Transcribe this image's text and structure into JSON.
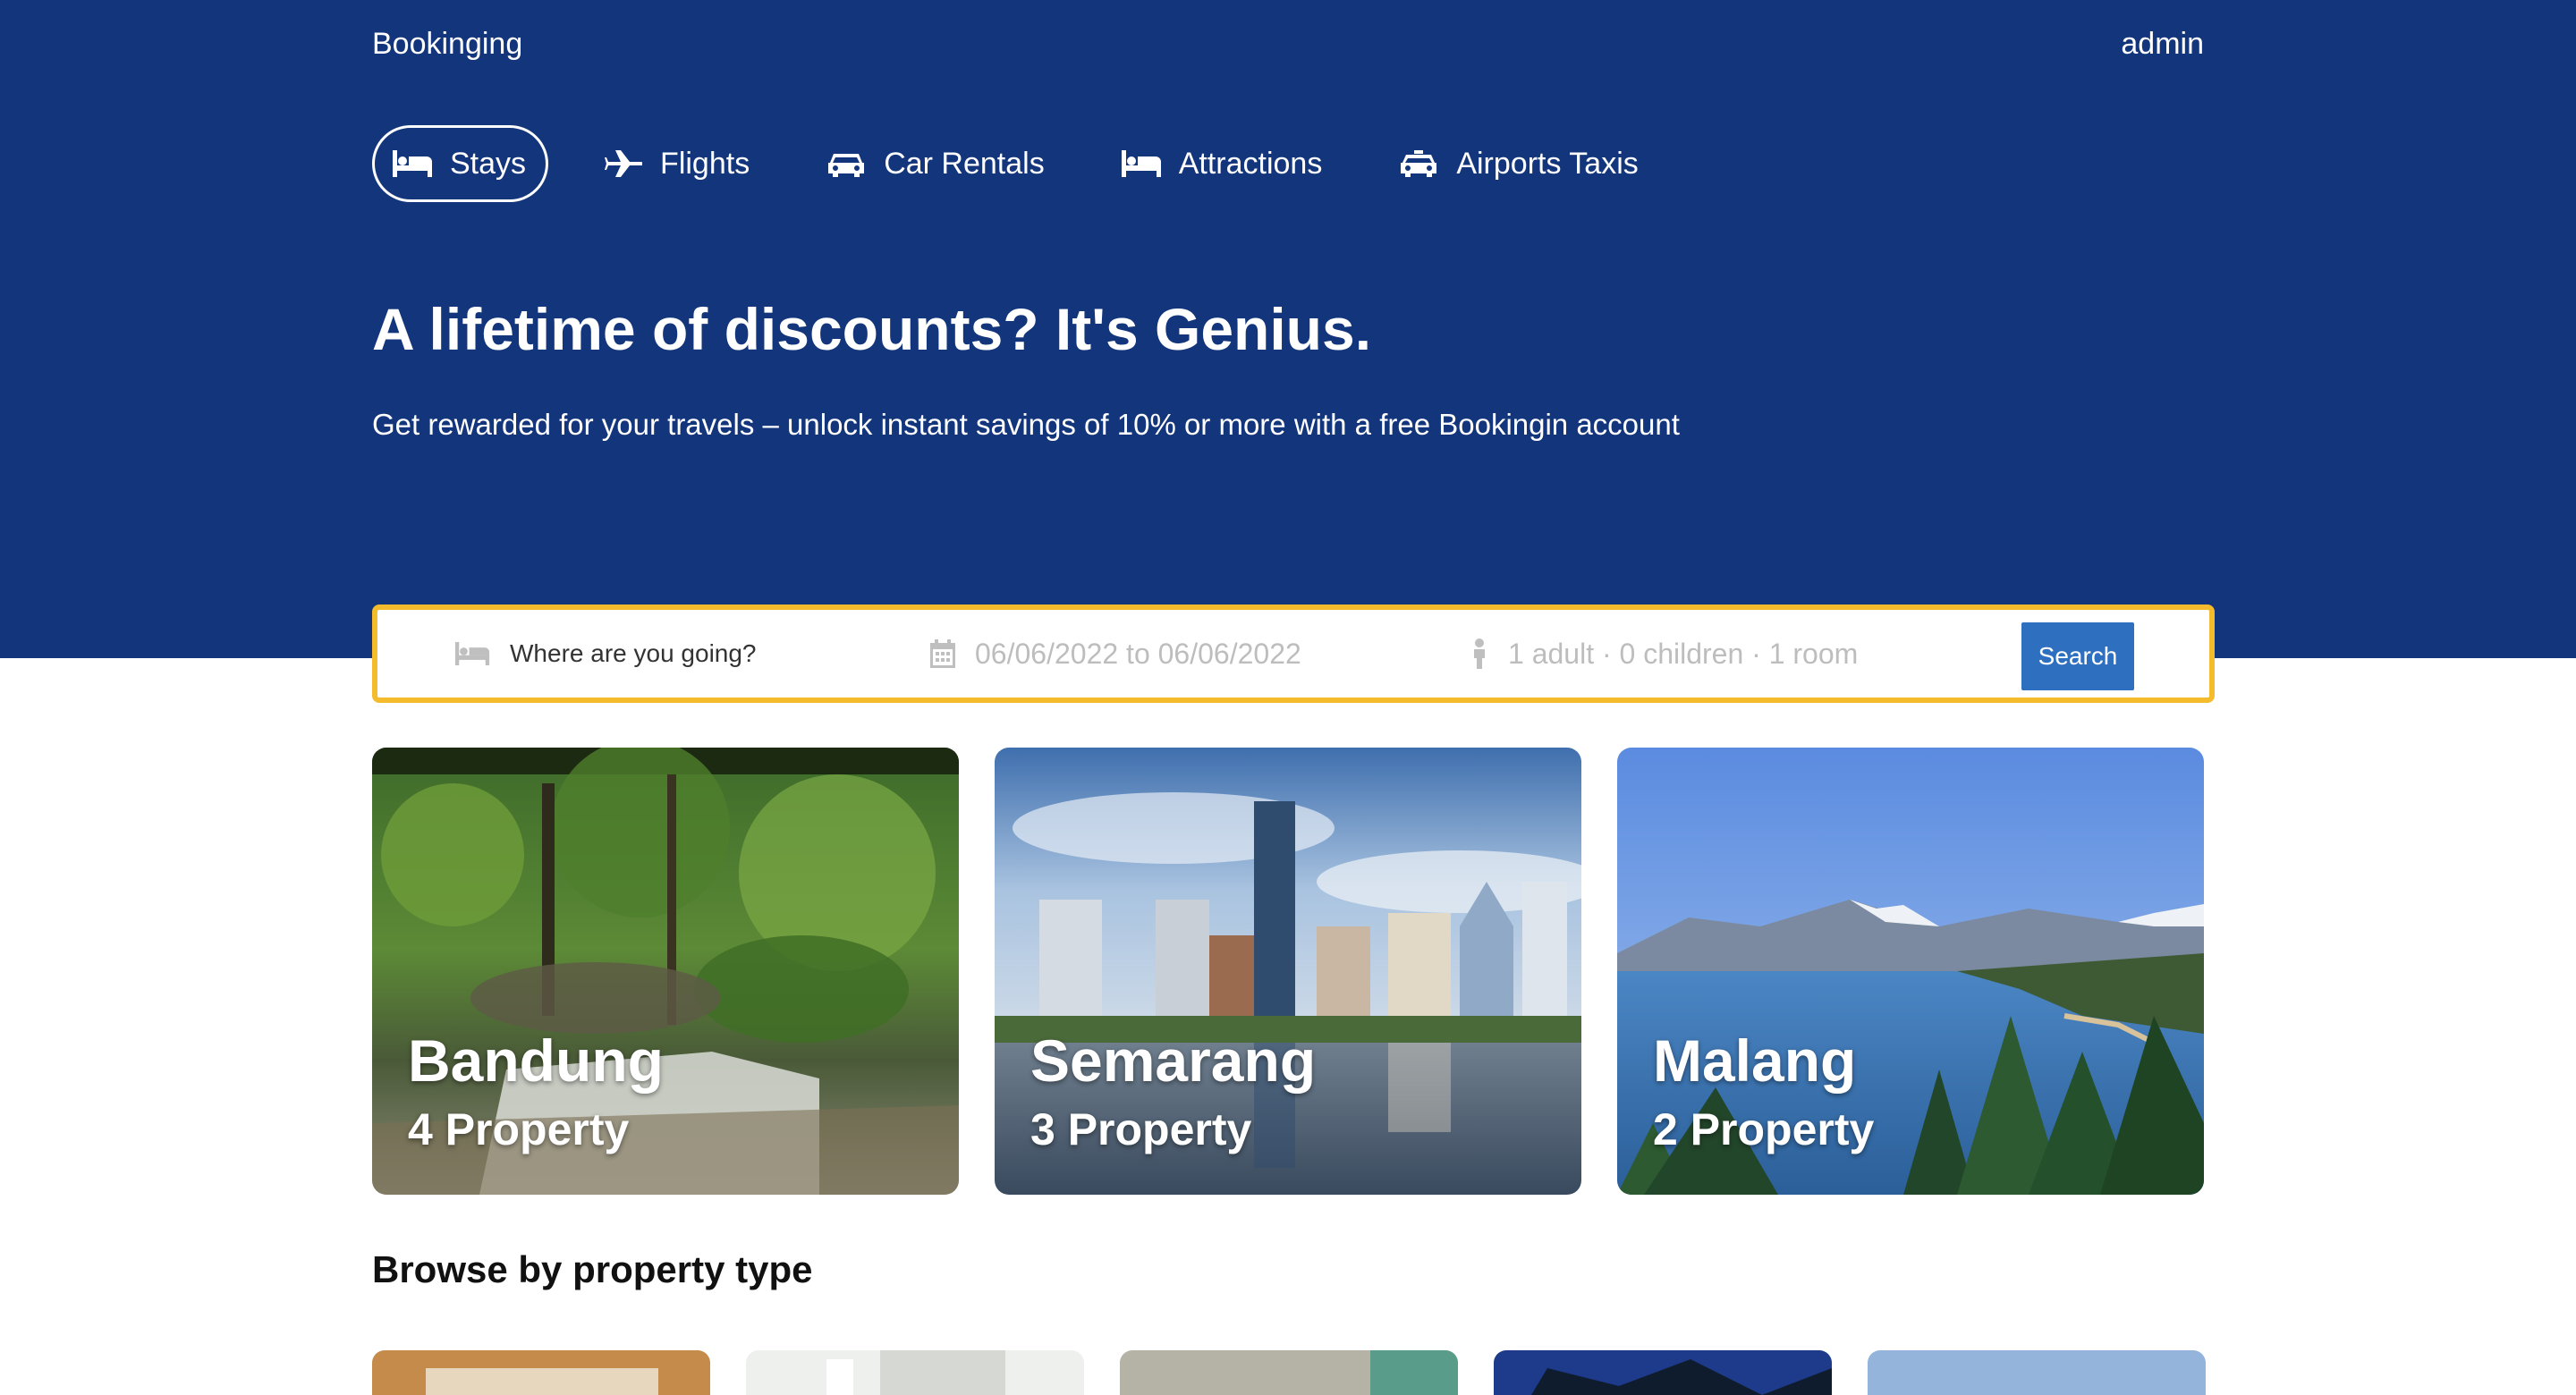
{
  "header": {
    "brand": "Bookinging",
    "user": "admin"
  },
  "nav": {
    "items": [
      {
        "label": "Stays",
        "icon": "bed-icon",
        "active": true
      },
      {
        "label": "Flights",
        "icon": "plane-icon",
        "active": false
      },
      {
        "label": "Car Rentals",
        "icon": "car-icon",
        "active": false
      },
      {
        "label": "Attractions",
        "icon": "bed-icon",
        "active": false
      },
      {
        "label": "Airports Taxis",
        "icon": "taxi-icon",
        "active": false
      }
    ]
  },
  "hero": {
    "headline": "A lifetime of discounts? It's Genius.",
    "subline": "Get rewarded for your travels – unlock instant savings of 10% or more with a free Bookingin account"
  },
  "search": {
    "destination_placeholder": "Where are you going?",
    "dates": "06/06/2022 to 06/06/2022",
    "guests": "1 adult · 0 children · 1 room",
    "button": "Search"
  },
  "cities": [
    {
      "name": "Bandung",
      "count": "4 Property"
    },
    {
      "name": "Semarang",
      "count": "3 Property"
    },
    {
      "name": "Malang",
      "count": "2 Property"
    }
  ],
  "browse": {
    "title": "Browse by property type"
  },
  "colors": {
    "hero": "#13357b",
    "accent": "#f4bb2d",
    "button": "#2f6fc0"
  }
}
